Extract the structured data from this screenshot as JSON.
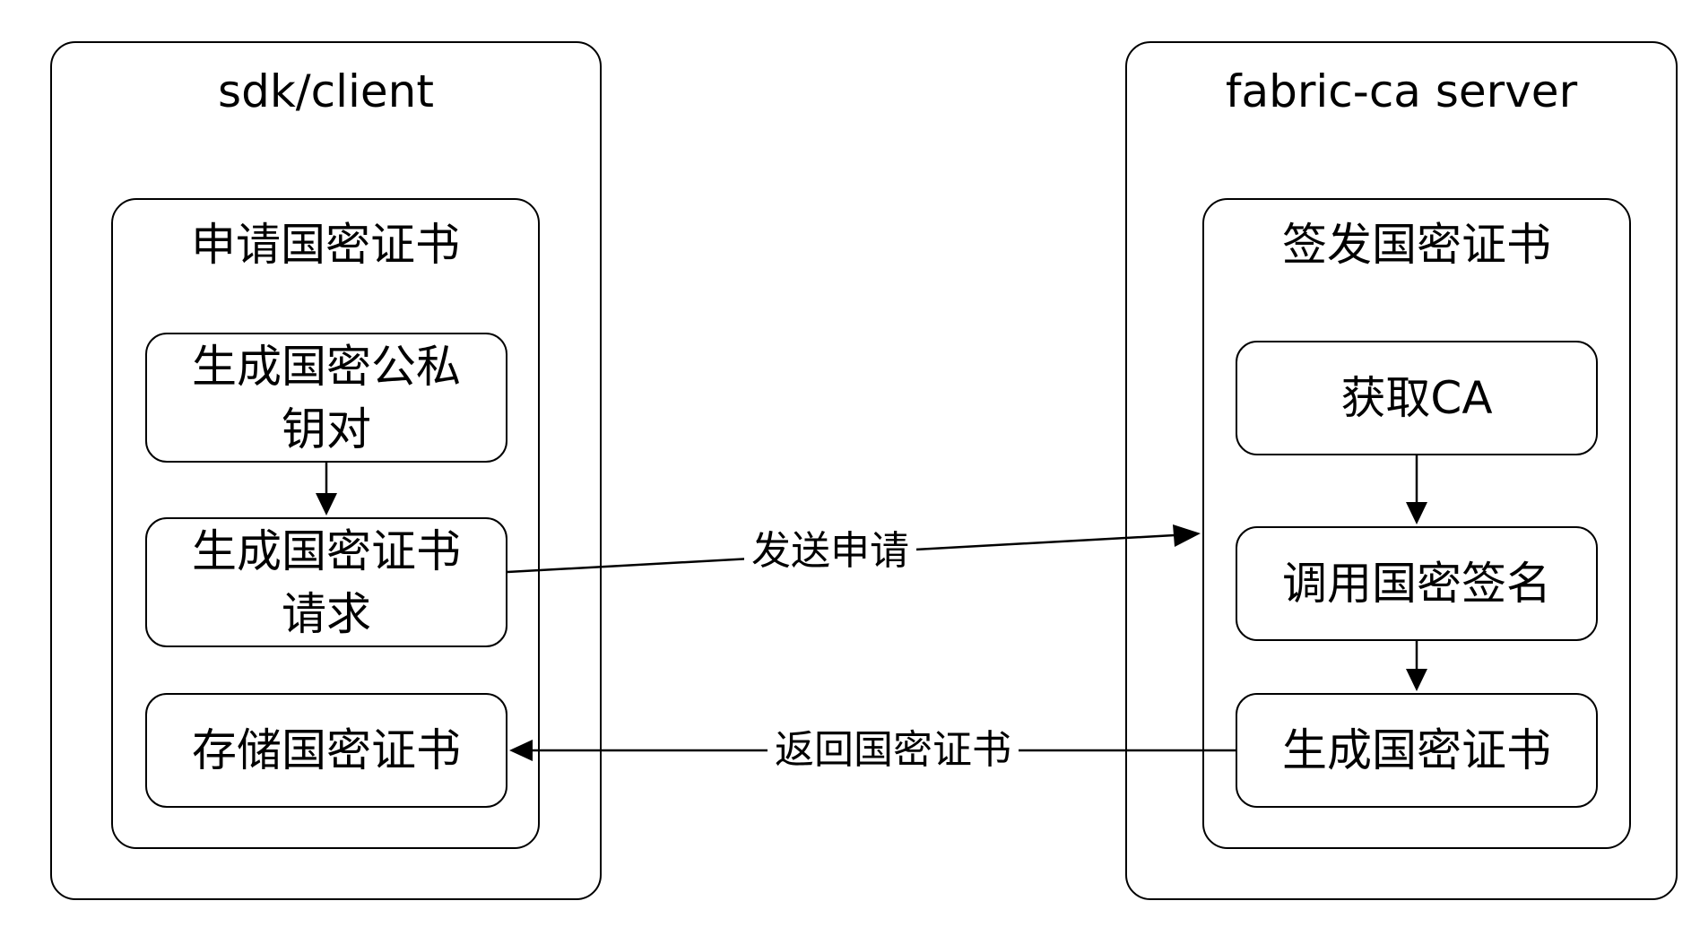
{
  "client": {
    "title": "sdk/client",
    "group_title": "申请国密证书",
    "nodes": {
      "generate_keypair": "生成国密公私\n钥对",
      "generate_csr": "生成国密证书\n请求",
      "store_cert": "存储国密证书"
    }
  },
  "server": {
    "title": "fabric-ca server",
    "group_title": "签发国密证书",
    "nodes": {
      "get_ca": "获取CA",
      "call_sign": "调用国密签名",
      "generate_cert": "生成国密证书"
    }
  },
  "edges": {
    "send_request": "发送申请",
    "return_cert": "返回国密证书"
  }
}
